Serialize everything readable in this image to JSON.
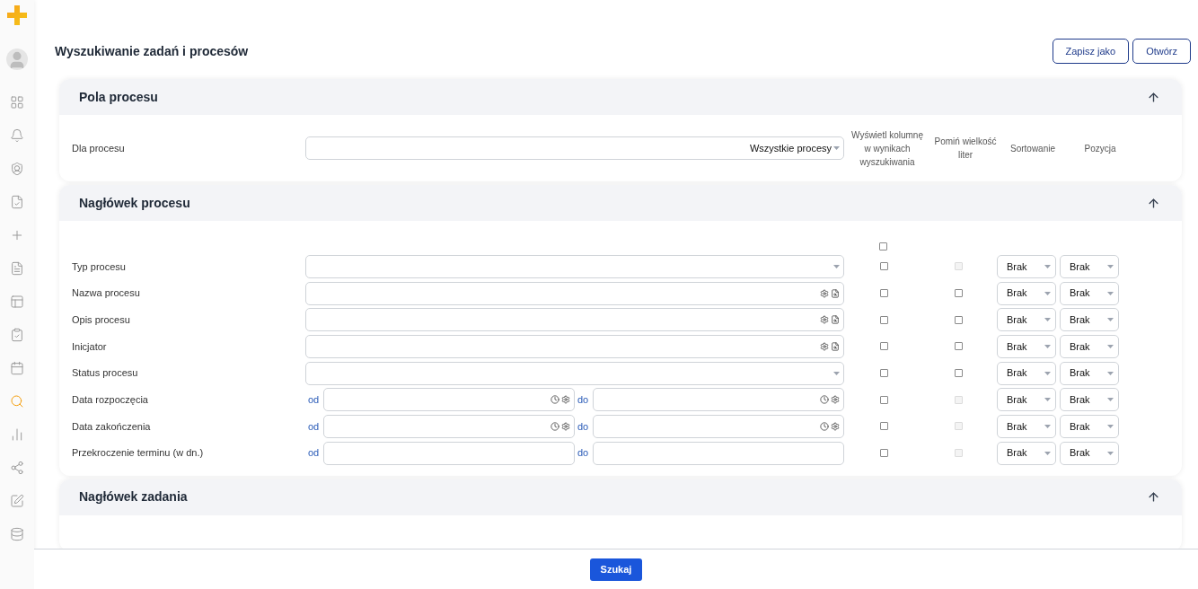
{
  "sidebar": {
    "items": [
      {
        "selected": false
      },
      {
        "selected": false
      },
      {
        "selected": false
      },
      {
        "selected": false
      },
      {
        "selected": false
      },
      {
        "selected": false
      },
      {
        "selected": false
      },
      {
        "selected": false
      },
      {
        "selected": false
      },
      {
        "selected": true
      },
      {
        "selected": false
      },
      {
        "selected": false
      },
      {
        "selected": false
      },
      {
        "selected": false
      }
    ]
  },
  "page": {
    "title": "Wyszukiwanie zadań i procesów",
    "actions": [
      "Zapisz jako",
      "Otwórz"
    ]
  },
  "process_fields": {
    "title": "Pola procesu",
    "expanded": true,
    "label": "Dla procesu",
    "value": "Wszystkie procesy",
    "columns": [
      "Wyświetl kolumnę w wynikach wyszukiwania",
      "Pomiń wielkość liter",
      "Sortowanie",
      "Pozycja"
    ]
  },
  "process_header": {
    "title": "Nagłówek procesu",
    "expanded": true,
    "select_all": {
      "checked": false
    },
    "rows": [
      {
        "label": "Typ procesu",
        "kind": "select",
        "show": false,
        "ignore_case": {
          "checked": false,
          "disabled": true
        },
        "sort": "Brak",
        "position": "Brak"
      },
      {
        "label": "Nazwa procesu",
        "kind": "text",
        "show": false,
        "ignore_case": {
          "checked": false,
          "disabled": false
        },
        "sort": "Brak",
        "position": "Brak"
      },
      {
        "label": "Opis procesu",
        "kind": "text",
        "show": false,
        "ignore_case": {
          "checked": false,
          "disabled": false
        },
        "sort": "Brak",
        "position": "Brak"
      },
      {
        "label": "Inicjator",
        "kind": "text",
        "show": false,
        "ignore_case": {
          "checked": false,
          "disabled": false
        },
        "sort": "Brak",
        "position": "Brak"
      },
      {
        "label": "Status procesu",
        "kind": "select",
        "show": false,
        "ignore_case": {
          "checked": false,
          "disabled": false
        },
        "sort": "Brak",
        "position": "Brak"
      },
      {
        "label": "Data rozpoczęcia",
        "kind": "date_range",
        "from": "od",
        "to": "do",
        "show": false,
        "ignore_case": {
          "checked": false,
          "disabled": true
        },
        "sort": "Brak",
        "position": "Brak"
      },
      {
        "label": "Data zakończenia",
        "kind": "date_range",
        "from": "od",
        "to": "do",
        "show": false,
        "ignore_case": {
          "checked": false,
          "disabled": true
        },
        "sort": "Brak",
        "position": "Brak"
      },
      {
        "label": "Przekroczenie terminu (w dn.)",
        "kind": "number_range",
        "from": "od",
        "to": "do",
        "show": false,
        "ignore_case": {
          "checked": false,
          "disabled": true
        },
        "sort": "Brak",
        "position": "Brak"
      }
    ]
  },
  "task_header": {
    "title": "Nagłówek zadania",
    "expanded": true
  },
  "footer": {
    "button": "Szukaj"
  }
}
